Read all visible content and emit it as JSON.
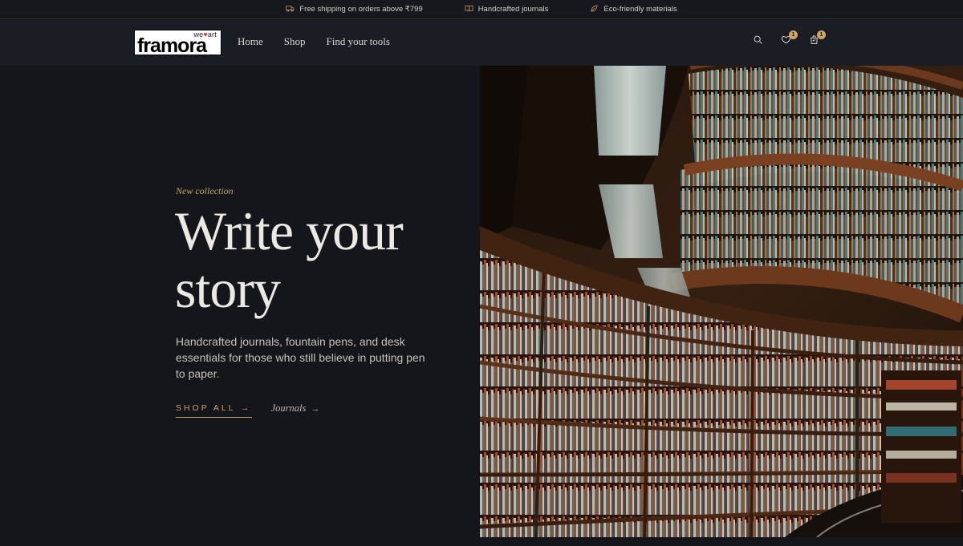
{
  "topbar": {
    "items": [
      {
        "icon": "truck-icon",
        "text": "Free shipping on orders above ₹799"
      },
      {
        "icon": "book-open-icon",
        "text": "Handcrafted journals"
      },
      {
        "icon": "leaf-icon",
        "text": "Eco-friendly materials"
      }
    ]
  },
  "header": {
    "logo": {
      "tagline_pre": "we",
      "tagline_post": "art",
      "wordmark": "framora"
    },
    "nav": [
      {
        "label": "Home"
      },
      {
        "label": "Shop"
      },
      {
        "label": "Find your tools"
      }
    ],
    "icons": {
      "search": "search-icon",
      "wishlist": "heart-icon",
      "wishlist_count": "1",
      "cart": "shopping-bag-icon",
      "cart_count": "1"
    }
  },
  "hero": {
    "eyebrow": "New collection",
    "headline": "Write your story",
    "subtext": "Handcrafted journals, fountain pens, and desk essentials for those who still believe in putting pen to paper.",
    "primary_cta": "SHOP ALL",
    "secondary_cta": "Journals",
    "arrow": "→"
  },
  "colors": {
    "accent": "#c9a46a",
    "background": "#14161b",
    "header_bg": "#1a1d24",
    "badge": "#d2a463"
  }
}
